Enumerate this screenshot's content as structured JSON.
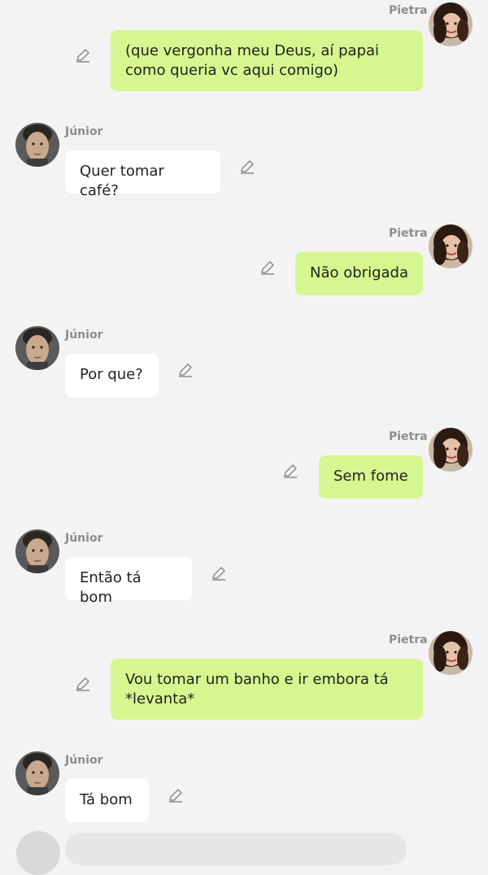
{
  "messages": [
    {
      "side": "her",
      "name": "Pietra",
      "text": "(que vergonha meu Deus, aí papai como queria vc aqui comigo)"
    },
    {
      "side": "him",
      "name": "Júnior",
      "text": "Quer tomar café?"
    },
    {
      "side": "her",
      "name": "Pietra",
      "text": "Não obrigada"
    },
    {
      "side": "him",
      "name": "Júnior",
      "text": "Por que?"
    },
    {
      "side": "her",
      "name": "Pietra",
      "text": "Sem fome"
    },
    {
      "side": "him",
      "name": "Júnior",
      "text": "Então tá bom"
    },
    {
      "side": "her",
      "name": "Pietra",
      "text": "Vou tomar um banho e ir embora tá *levanta*"
    },
    {
      "side": "him",
      "name": "Júnior",
      "text": "Tá bom"
    }
  ],
  "icons": {
    "edit": "pencil-icon",
    "avatar_her": "avatar-pietra",
    "avatar_him": "avatar-junior"
  },
  "colors": {
    "background": "#f3f3f3",
    "her_bubble": "#d6f78f",
    "him_bubble": "#ffffff",
    "name_text": "#8d8d8d"
  }
}
